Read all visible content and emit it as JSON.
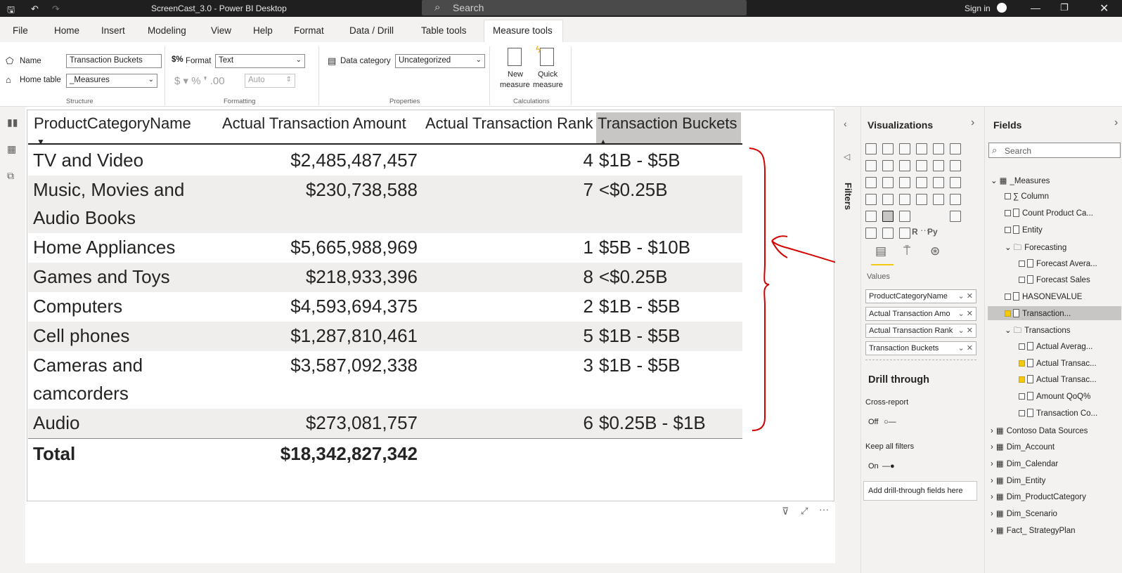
{
  "window": {
    "title": "ScreenCast_3.0 - Power BI Desktop",
    "search_placeholder": "Search",
    "sign_in": "Sign in"
  },
  "ribbon_tabs": [
    "File",
    "Home",
    "Insert",
    "Modeling",
    "View",
    "Help",
    "Format",
    "Data / Drill",
    "Table tools",
    "Measure tools"
  ],
  "ribbon": {
    "name_label": "Name",
    "name_value": "Transaction Buckets",
    "home_table_label": "Home table",
    "home_table_value": "_Measures",
    "structure_group": "Structure",
    "format_label": "Format",
    "format_value": "Text",
    "currency_symbols": "$ ▾ %  ❜ .00",
    "auto_value": "Auto",
    "formatting_group": "Formatting",
    "data_category_label": "Data category",
    "data_category_value": "Uncategorized",
    "properties_group": "Properties",
    "new_measure": "New\nmeasure",
    "quick_measure": "Quick\nmeasure",
    "new_measure_l1": "New",
    "new_measure_l2": "measure",
    "quick_measure_l1": "Quick",
    "quick_measure_l2": "measure",
    "calculations_group": "Calculations"
  },
  "table": {
    "headers": [
      "ProductCategoryName",
      "Actual Transaction Amount",
      "Actual Transaction Rank",
      "Transaction Buckets"
    ],
    "rows": [
      {
        "category_l1": "TV and Video",
        "category_l2": "",
        "amount": "$2,485,487,457",
        "rank": "4",
        "bucket": "$1B - $5B"
      },
      {
        "category_l1": "Music, Movies and",
        "category_l2": "Audio Books",
        "amount": "$230,738,588",
        "rank": "7",
        "bucket": "<$0.25B"
      },
      {
        "category_l1": "Home Appliances",
        "category_l2": "",
        "amount": "$5,665,988,969",
        "rank": "1",
        "bucket": "$5B - $10B"
      },
      {
        "category_l1": "Games and Toys",
        "category_l2": "",
        "amount": "$218,933,396",
        "rank": "8",
        "bucket": "<$0.25B"
      },
      {
        "category_l1": "Computers",
        "category_l2": "",
        "amount": "$4,593,694,375",
        "rank": "2",
        "bucket": "$1B - $5B"
      },
      {
        "category_l1": "Cell phones",
        "category_l2": "",
        "amount": "$1,287,810,461",
        "rank": "5",
        "bucket": "$1B - $5B"
      },
      {
        "category_l1": "Cameras and",
        "category_l2": "camcorders",
        "amount": "$3,587,092,338",
        "rank": "3",
        "bucket": "$1B - $5B"
      },
      {
        "category_l1": "Audio",
        "category_l2": "",
        "amount": "$273,081,757",
        "rank": "6",
        "bucket": "$0.25B - $1B"
      }
    ],
    "total_label": "Total",
    "total_amount": "$18,342,827,342"
  },
  "filters_label": "Filters",
  "visualizations": {
    "title": "Visualizations",
    "values_label": "Values",
    "wells": [
      "ProductCategoryName",
      "Actual Transaction Amo",
      "Actual Transaction Rank",
      "Transaction Buckets"
    ],
    "drill_through": "Drill through",
    "cross_report": "Cross-report",
    "off": "Off",
    "keep_all_filters": "Keep all filters",
    "on": "On",
    "add_drill": "Add drill-through fields here",
    "r_icon": "R",
    "py_icon": "Py",
    "more": "···"
  },
  "fields": {
    "title": "Fields",
    "search_placeholder": "Search",
    "items": [
      {
        "label": "_Measures",
        "indent": 0,
        "kind": "table-open",
        "checked": false
      },
      {
        "label": "∑ Column",
        "indent": 1,
        "kind": "field",
        "checked": false
      },
      {
        "label": "Count Product Ca...",
        "indent": 1,
        "kind": "calc",
        "checked": false
      },
      {
        "label": "Entity",
        "indent": 1,
        "kind": "calc",
        "checked": false
      },
      {
        "label": "Forecasting",
        "indent": 1,
        "kind": "folder-open",
        "checked": false
      },
      {
        "label": "Forecast Avera...",
        "indent": 2,
        "kind": "calc",
        "checked": false
      },
      {
        "label": "Forecast Sales",
        "indent": 2,
        "kind": "calc",
        "checked": false
      },
      {
        "label": "HASONEVALUE",
        "indent": 1,
        "kind": "calc",
        "checked": false
      },
      {
        "label": "Transaction...",
        "indent": 1,
        "kind": "calc",
        "checked": true
      },
      {
        "label": "Transactions",
        "indent": 1,
        "kind": "folder-open",
        "checked": false
      },
      {
        "label": "Actual Averag...",
        "indent": 2,
        "kind": "calc",
        "checked": false
      },
      {
        "label": "Actual Transac...",
        "indent": 2,
        "kind": "calc",
        "checked": true
      },
      {
        "label": "Actual Transac...",
        "indent": 2,
        "kind": "calc",
        "checked": true
      },
      {
        "label": "Amount QoQ%",
        "indent": 2,
        "kind": "calc",
        "checked": false
      },
      {
        "label": "Transaction Co...",
        "indent": 2,
        "kind": "calc",
        "checked": false
      },
      {
        "label": "Contoso Data Sources",
        "indent": 0,
        "kind": "table",
        "checked": false
      },
      {
        "label": "Dim_Account",
        "indent": 0,
        "kind": "table",
        "checked": false
      },
      {
        "label": "Dim_Calendar",
        "indent": 0,
        "kind": "table",
        "checked": false
      },
      {
        "label": "Dim_Entity",
        "indent": 0,
        "kind": "table",
        "checked": false
      },
      {
        "label": "Dim_ProductCategory",
        "indent": 0,
        "kind": "table",
        "checked": false
      },
      {
        "label": "Dim_Scenario",
        "indent": 0,
        "kind": "table",
        "checked": false
      },
      {
        "label": "Fact_ StrategyPlan",
        "indent": 0,
        "kind": "table",
        "checked": false
      }
    ]
  },
  "colors": {
    "accent": "#f2c811",
    "annotation": "#d40000",
    "alt_row": "#efeeed",
    "selected_header": "#c8c6c4"
  }
}
